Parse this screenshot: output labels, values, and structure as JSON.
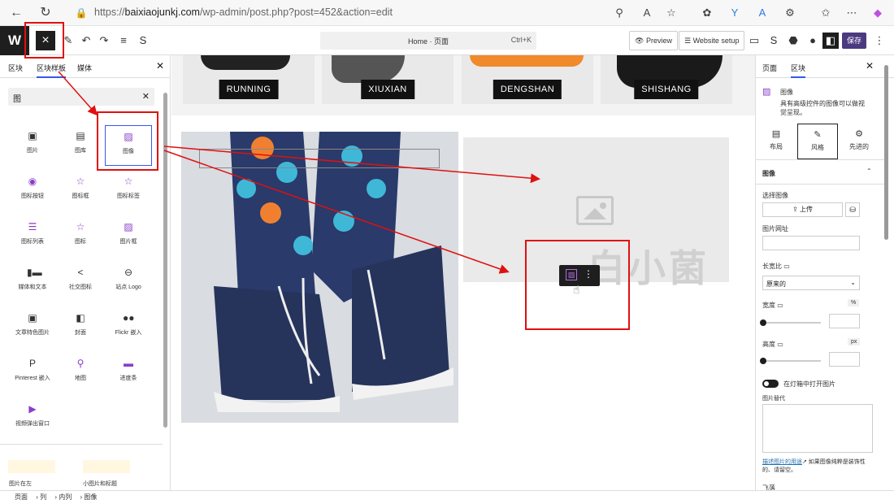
{
  "browser": {
    "url_prefix": "https://",
    "url_host": "baixiaojunkj.com",
    "url_path": "/wp-admin/post.php?post=452&action=edit"
  },
  "toolbar": {
    "command_label": "Home · 页面",
    "command_shortcut": "Ctrl+K",
    "preview_label": "Preview",
    "website_setup_label": "Website setup",
    "save_label": "保存"
  },
  "left_panel": {
    "tabs": [
      "区块",
      "区块样板",
      "媒体"
    ],
    "search_value": "图",
    "blocks": [
      {
        "label": "图片",
        "icon": "image-icon"
      },
      {
        "label": "图库",
        "icon": "gallery-icon"
      },
      {
        "label": "图像",
        "icon": "image-advanced-icon"
      },
      {
        "label": "图标按钮",
        "icon": "icon-button-icon"
      },
      {
        "label": "图标框",
        "icon": "icon-box-icon"
      },
      {
        "label": "图标标签",
        "icon": "icon-label-icon"
      },
      {
        "label": "图标列表",
        "icon": "icon-list-icon"
      },
      {
        "label": "图标",
        "icon": "star-icon"
      },
      {
        "label": "图片框",
        "icon": "image-box-icon"
      },
      {
        "label": "媒体和文本",
        "icon": "media-text-icon"
      },
      {
        "label": "社交图标",
        "icon": "share-icon"
      },
      {
        "label": "站点 Logo",
        "icon": "site-logo-icon"
      },
      {
        "label": "文章特色图片",
        "icon": "featured-image-icon"
      },
      {
        "label": "封面",
        "icon": "cover-icon"
      },
      {
        "label": "Flickr 嵌入",
        "icon": "flickr-icon"
      },
      {
        "label": "Pinterest 嵌入",
        "icon": "pinterest-icon"
      },
      {
        "label": "地图",
        "icon": "map-pin-icon"
      },
      {
        "label": "进度条",
        "icon": "progress-bar-icon"
      },
      {
        "label": "视频弹出窗口",
        "icon": "video-popup-icon"
      }
    ],
    "patterns": [
      "图片在左",
      "小图片和标题"
    ]
  },
  "canvas": {
    "shoe_labels": [
      "RUNNING",
      "XIUXIAN",
      "DENGSHAN",
      "SHISHANG"
    ],
    "watermark": "白小菌"
  },
  "right_panel": {
    "tabs": [
      "页面",
      "区块"
    ],
    "block_name": "图像",
    "block_desc": "具有高级控件的图像可以做视觉呈现。",
    "style_tabs": [
      "布局",
      "风格",
      "先进的"
    ],
    "section_title": "图像",
    "choose_image": "选择图像",
    "upload_label": "上传",
    "image_url_label": "图片网址",
    "aspect_label": "长宽比",
    "aspect_value": "原来的",
    "width_label": "宽度",
    "width_unit": "%",
    "height_label": "高度",
    "height_unit": "px",
    "lightbox_label": "在灯箱中打开图片",
    "alt_label": "图片替代",
    "help_link": "描述图片的用途",
    "help_text": "↗ 如果图像纯粹是装饰性的、请留空。",
    "next_label": "飞落"
  },
  "breadcrumb": [
    "页面",
    "列",
    "内列",
    "图像"
  ],
  "colors": {
    "accent": "#3858e9",
    "save": "#4b3a7f",
    "annotation": "#e01010"
  }
}
